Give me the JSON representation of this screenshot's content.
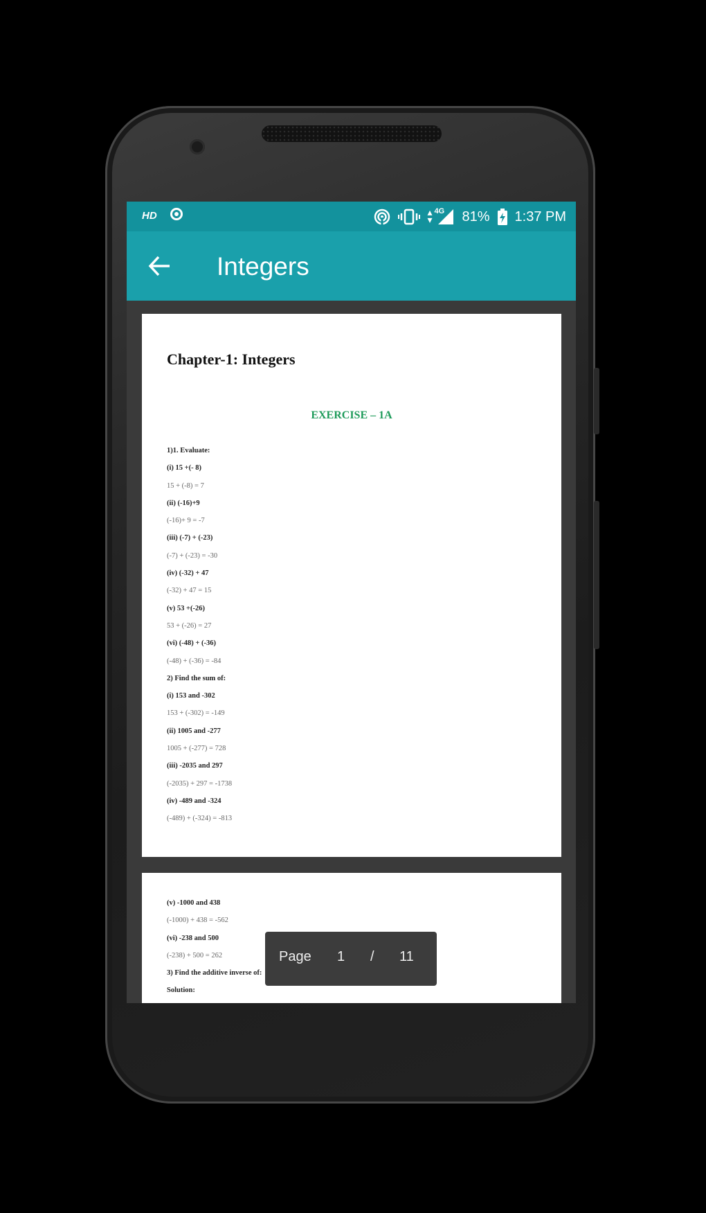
{
  "status_bar": {
    "hd": "HD",
    "battery": "81%",
    "time": "1:37 PM",
    "network": "4G"
  },
  "app_bar": {
    "title": "Integers",
    "back_icon": "arrow-left-icon"
  },
  "document": {
    "chapter_title": "Chapter-1: Integers",
    "exercise_title": "EXERCISE – 1A",
    "page1_lines": [
      {
        "t": "1)1. Evaluate:",
        "k": "q"
      },
      {
        "t": "(i) 15 +(- 8)",
        "k": "q"
      },
      {
        "t": "15 + (-8) = 7",
        "k": "a"
      },
      {
        "t": "(ii) (-16)+9",
        "k": "q"
      },
      {
        "t": "(-16)+ 9 = -7",
        "k": "a"
      },
      {
        "t": "(iii) (-7) + (-23)",
        "k": "q"
      },
      {
        "t": "(-7) + (-23) = -30",
        "k": "a"
      },
      {
        "t": "(iv) (-32) + 47",
        "k": "q"
      },
      {
        "t": "(-32) + 47 = 15",
        "k": "a"
      },
      {
        "t": "(v) 53 +(-26)",
        "k": "q"
      },
      {
        "t": "53 + (-26) = 27",
        "k": "a"
      },
      {
        "t": "(vi) (-48) + (-36)",
        "k": "q"
      },
      {
        "t": "(-48) + (-36) = -84",
        "k": "a"
      },
      {
        "t": "2) Find the sum of:",
        "k": "q"
      },
      {
        "t": "(i) 153 and -302",
        "k": "q"
      },
      {
        "t": "153 + (-302) = -149",
        "k": "a"
      },
      {
        "t": "(ii) 1005 and -277",
        "k": "q"
      },
      {
        "t": "1005 + (-277) = 728",
        "k": "a"
      },
      {
        "t": "(iii) -2035 and 297",
        "k": "q"
      },
      {
        "t": "(-2035) + 297 = -1738",
        "k": "a"
      },
      {
        "t": "(iv) -489 and -324",
        "k": "q"
      },
      {
        "t": "(-489) + (-324) = -813",
        "k": "a"
      }
    ],
    "page2_lines": [
      {
        "t": "(v) -1000 and 438",
        "k": "q"
      },
      {
        "t": "(-1000) + 438 = -562",
        "k": "a"
      },
      {
        "t": "(vi) -238 and 500",
        "k": "q"
      },
      {
        "t": "(-238) + 500 = 262",
        "k": "a"
      },
      {
        "t": "3) Find the additive inverse of:",
        "k": "q"
      },
      {
        "t": "Solution:",
        "k": "q"
      }
    ]
  },
  "page_indicator": {
    "label": "Page",
    "current": "1",
    "separator": "/",
    "total": "11"
  }
}
